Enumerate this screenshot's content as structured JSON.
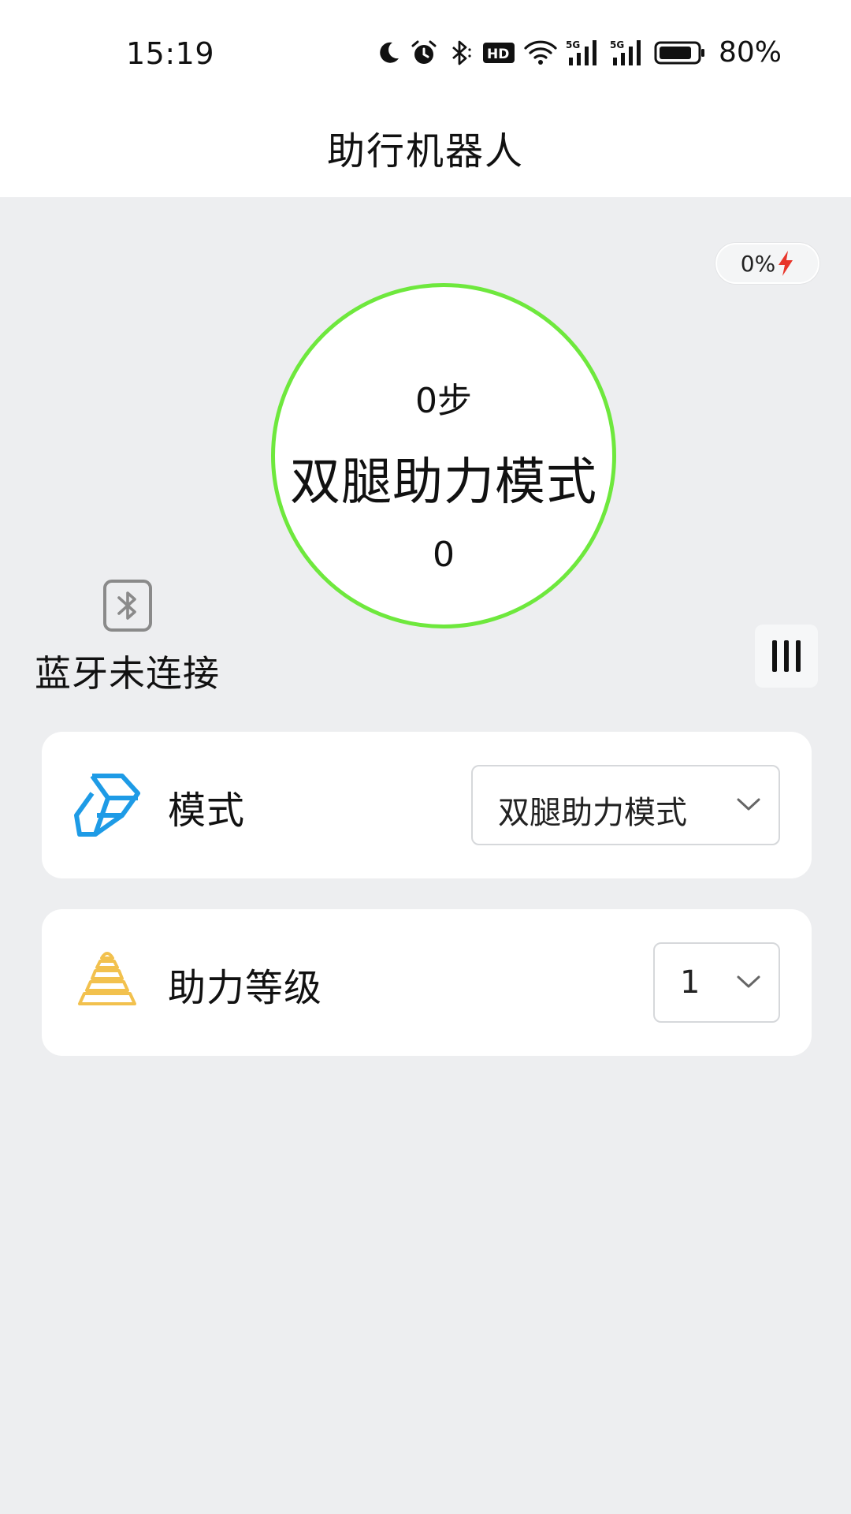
{
  "status_bar": {
    "time": "15:19",
    "battery_percent": "80%",
    "icons": [
      "moon-icon",
      "alarm-icon",
      "bluetooth-icon",
      "hd-icon",
      "wifi-icon",
      "signal-5g-icon",
      "signal-5g-icon",
      "battery-icon"
    ]
  },
  "header": {
    "title": "助行机器人"
  },
  "device_battery": {
    "text": "0%",
    "icon": "charging-bolt-icon",
    "bolt_color": "#e8352a"
  },
  "dashboard": {
    "steps": "0步",
    "mode": "双腿助力模式",
    "value": "0",
    "ring_color": "#6ee83d"
  },
  "bluetooth": {
    "status": "蓝牙未连接",
    "icon": "bluetooth-icon"
  },
  "settings": {
    "mode": {
      "label": "模式",
      "selected": "双腿助力模式",
      "icon": "cube-icon",
      "icon_color": "#1e9be6"
    },
    "assist_level": {
      "label": "助力等级",
      "selected": "1",
      "icon": "pyramid-icon",
      "icon_color": "#f2c14e"
    }
  }
}
